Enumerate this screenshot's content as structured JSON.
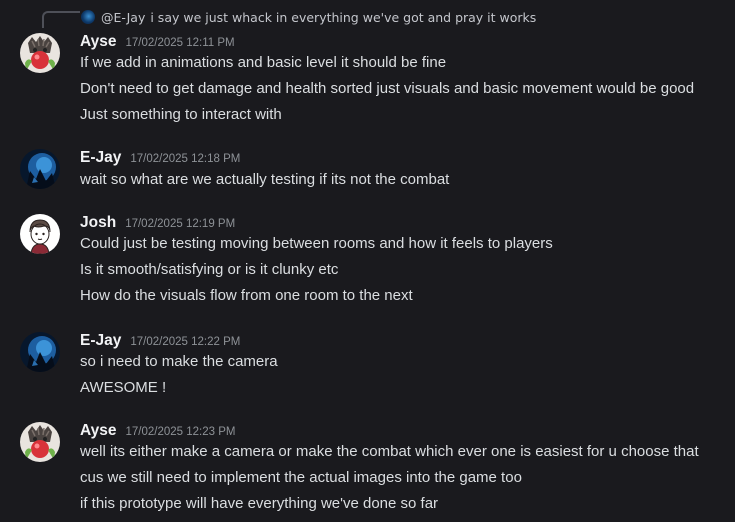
{
  "reply": {
    "mention": "@E-Jay",
    "text": "i say we just whack in everything we've got and pray it works"
  },
  "messages": [
    {
      "author": "Ayse",
      "time": "17/02/2025 12:11 PM",
      "avatar": "ayse-avatar",
      "lines": [
        "If we add in animations and basic level it should be fine",
        "Don't need to get damage and health sorted just visuals and basic movement would be good",
        "Just something to interact with"
      ]
    },
    {
      "author": "E-Jay",
      "time": "17/02/2025 12:18 PM",
      "avatar": "ejay-avatar",
      "lines": [
        "wait so what are we actually testing if its not the combat"
      ]
    },
    {
      "author": "Josh",
      "time": "17/02/2025 12:19 PM",
      "avatar": "josh-avatar",
      "lines": [
        "Could just be testing moving between rooms and how it feels to players",
        "Is it smooth/satisfying or is it clunky etc",
        "How do the visuals flow from one room to the next"
      ]
    },
    {
      "author": "E-Jay",
      "time": "17/02/2025 12:22 PM",
      "avatar": "ejay-avatar",
      "lines": [
        "so i need to make the camera",
        "AWESOME !"
      ]
    },
    {
      "author": "Ayse",
      "time": "17/02/2025 12:23 PM",
      "avatar": "ayse-avatar",
      "lines": [
        "well its either make a camera or make the combat which ever one is easiest for u choose  that",
        "cus we still need to implement the actual images into the game too",
        "if this prototype will have everything we've done so far"
      ]
    }
  ],
  "colors": {
    "background": "#1a1a1e",
    "username": "#f2f3f5",
    "timestamp": "#8e9297",
    "message_text": "#dbdee1"
  }
}
